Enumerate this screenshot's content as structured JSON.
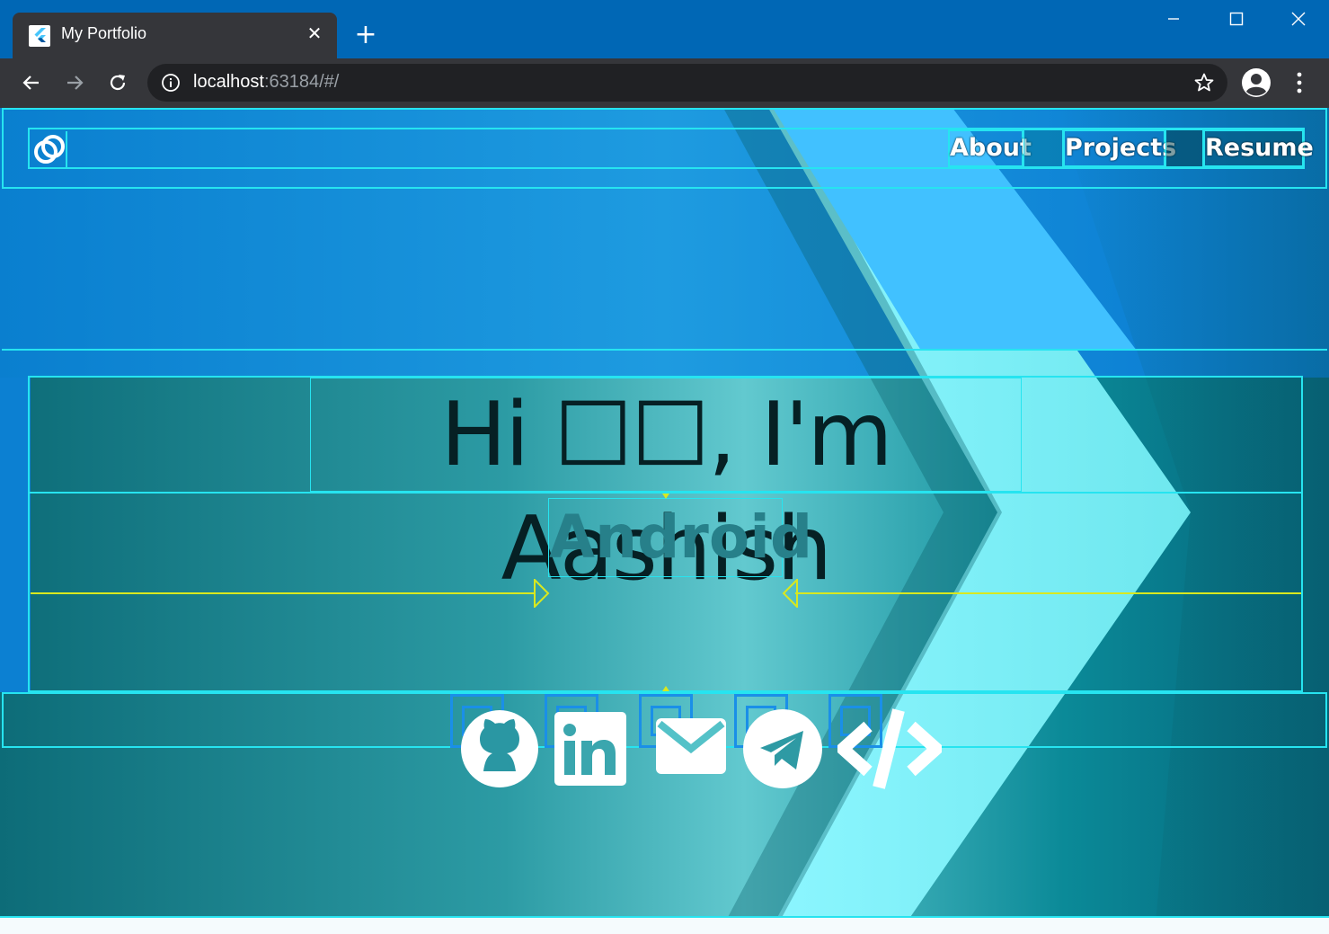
{
  "browser": {
    "tab_title": "My Portfolio",
    "tab_close": "✕",
    "new_tab": "+",
    "url_host": "localhost",
    "url_rest": ":63184/#/",
    "window_min": "—",
    "window_max": "☐",
    "window_close": "✕"
  },
  "header": {
    "nav": [
      {
        "label": "About"
      },
      {
        "label": "Projects"
      },
      {
        "label": "Resume"
      }
    ]
  },
  "hero": {
    "title": "Hi ☐☐, I'm Aashish",
    "subtitle": "Android"
  },
  "social_links": [
    {
      "name": "github-icon"
    },
    {
      "name": "linkedin-icon"
    },
    {
      "name": "email-icon"
    },
    {
      "name": "telegram-icon"
    },
    {
      "name": "code-icon"
    }
  ],
  "colors": {
    "debug_outline": "#26e4f0",
    "debug_arrow": "#d9e81f",
    "chrome_bg": "#0067b5",
    "toolbar_bg": "#35363a"
  }
}
